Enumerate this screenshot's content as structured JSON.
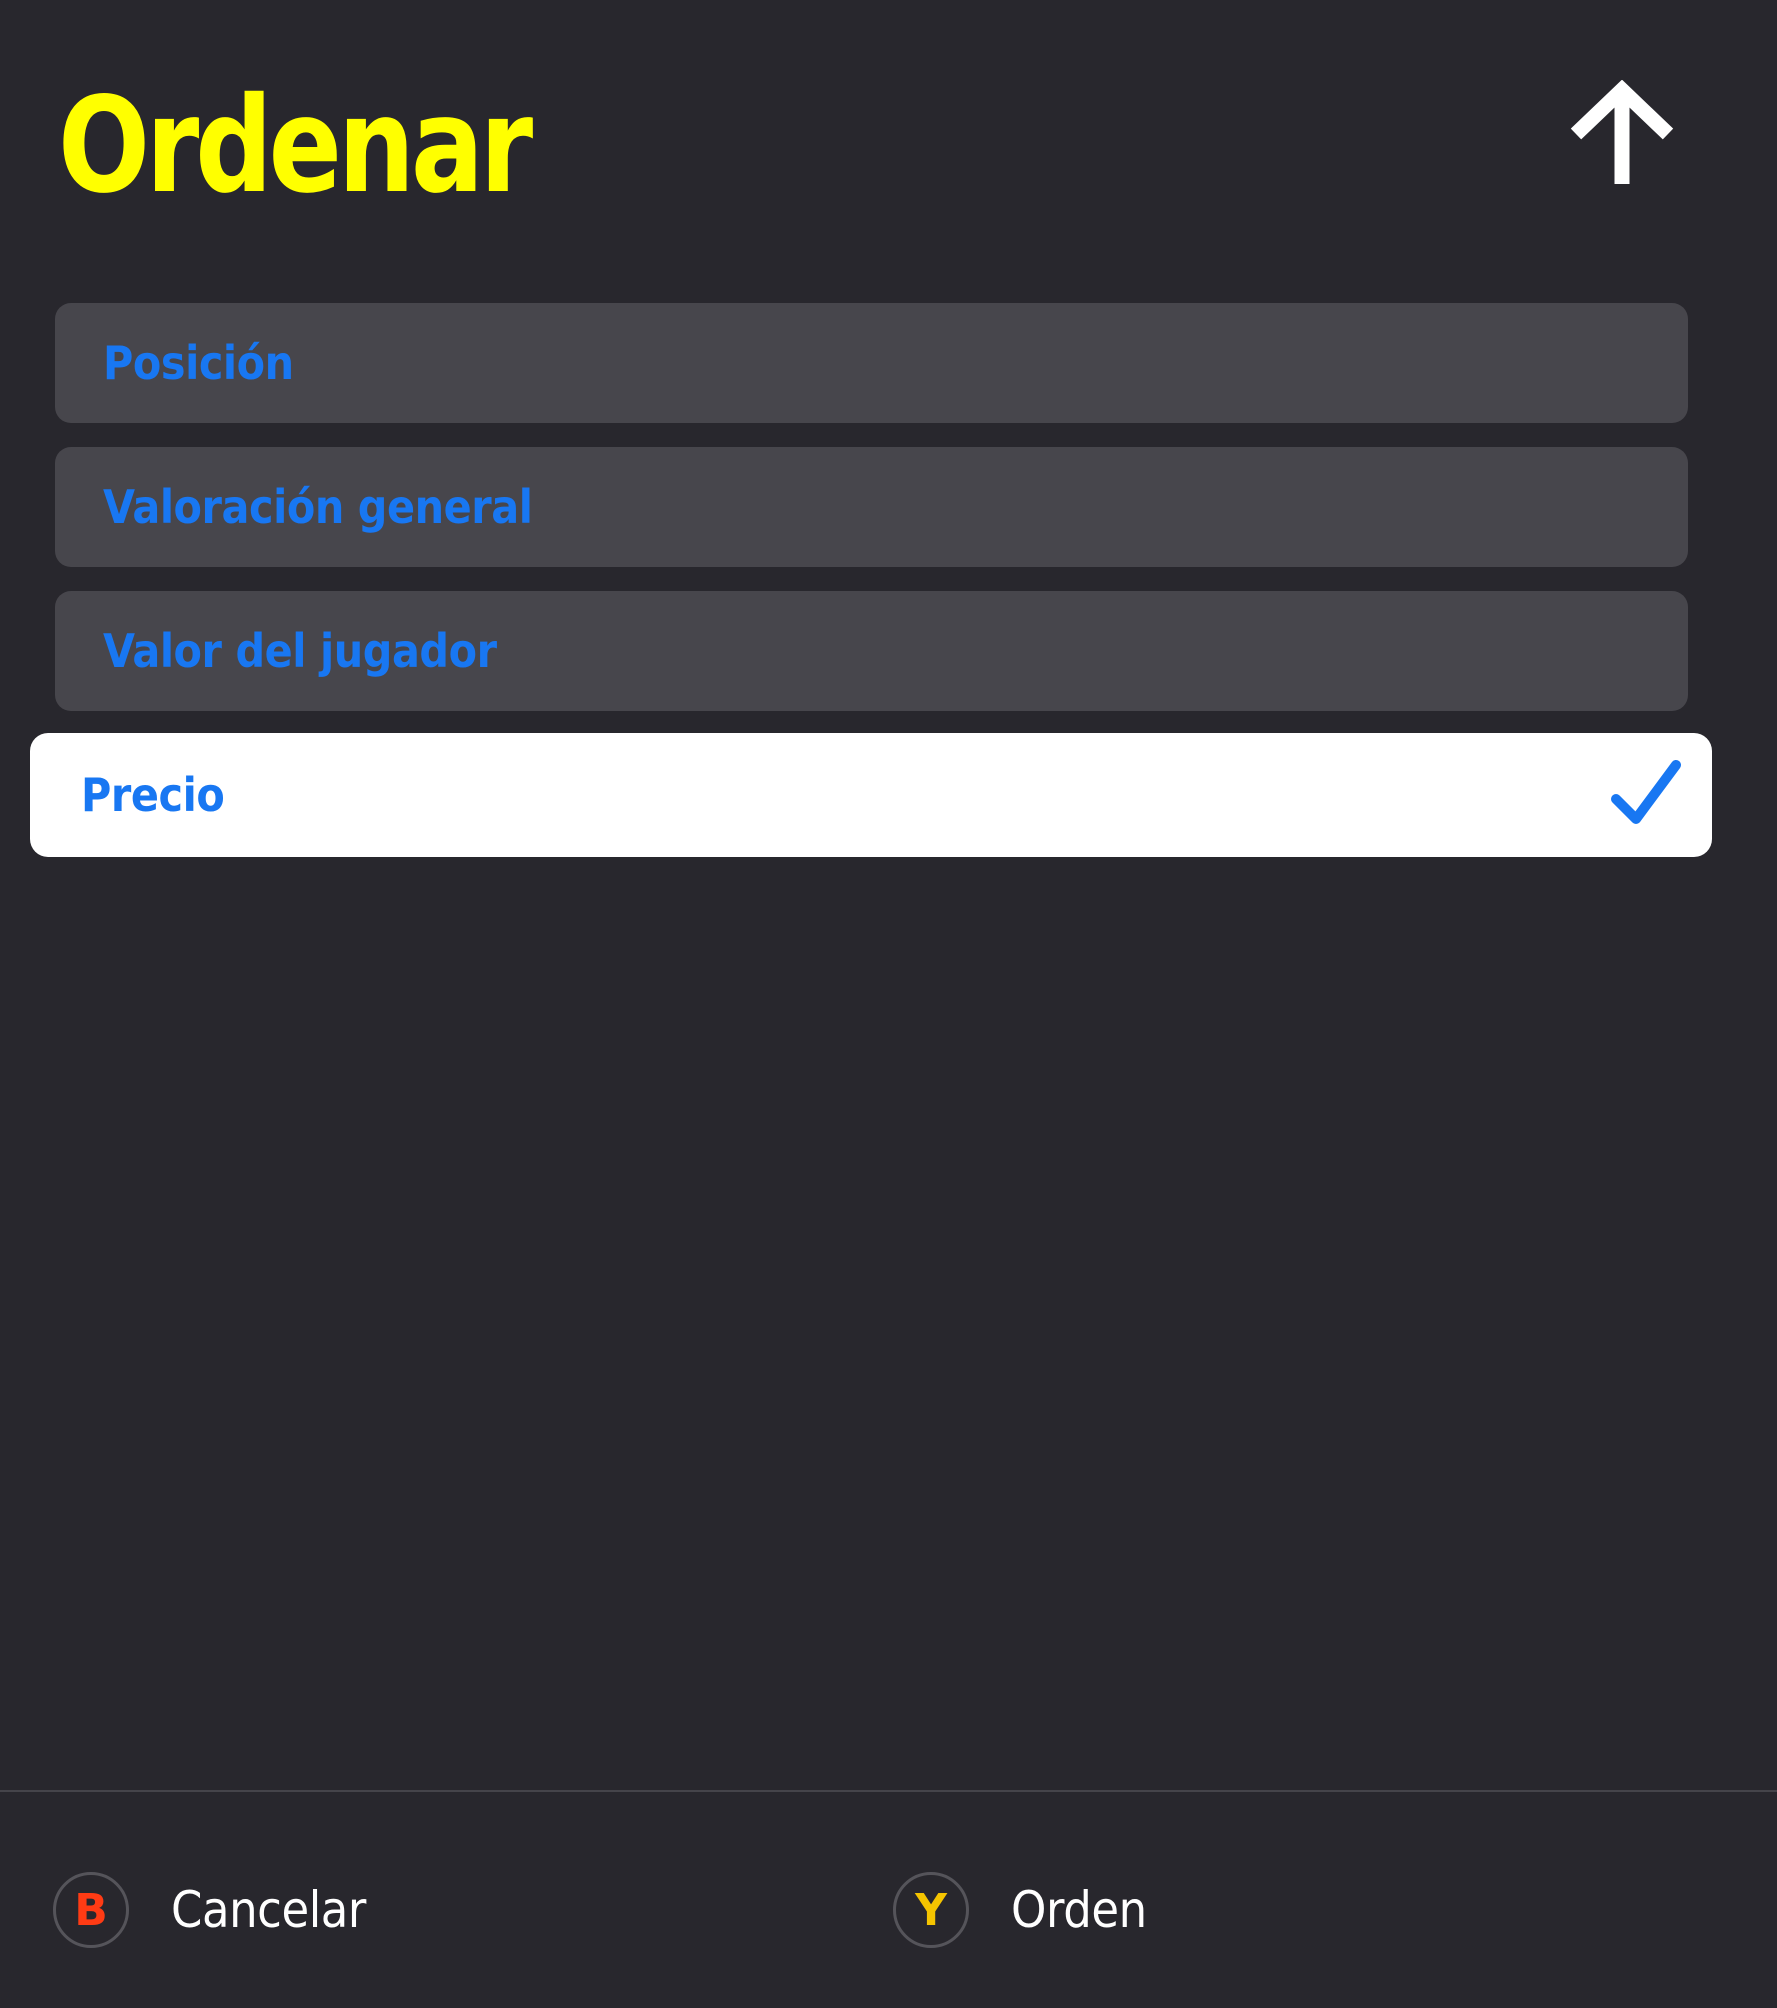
{
  "header": {
    "title": "Ordenar",
    "sort_direction_icon": "arrow-up-icon"
  },
  "options": [
    {
      "label": "Posición",
      "selected": false
    },
    {
      "label": "Valoración general",
      "selected": false
    },
    {
      "label": "Valor del jugador",
      "selected": false
    },
    {
      "label": "Precio",
      "selected": true
    }
  ],
  "footer": {
    "cancel": {
      "button": "B",
      "label": "Cancelar"
    },
    "order": {
      "button": "Y",
      "label": "Orden"
    }
  },
  "colors": {
    "background": "#28272d",
    "title": "#ffff00",
    "option_bg": "#47464c",
    "option_text": "#1877f2",
    "selected_bg": "#ffffff",
    "b_button": "#ff3b14",
    "y_button": "#f5c400"
  }
}
